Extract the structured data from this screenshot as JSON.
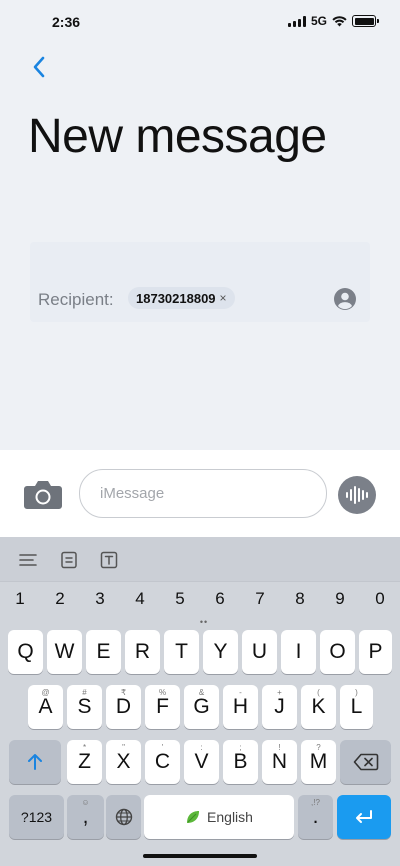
{
  "status_bar": {
    "time": "2:36",
    "network": "5G"
  },
  "header": {
    "title": "New message"
  },
  "recipient": {
    "label": "Recipient:",
    "chip_number": "18730218809",
    "chip_remove": "×"
  },
  "compose": {
    "placeholder": "iMessage"
  },
  "keyboard": {
    "numbers": [
      "1",
      "2",
      "3",
      "4",
      "5",
      "6",
      "7",
      "8",
      "9",
      "0"
    ],
    "row1": [
      "Q",
      "W",
      "E",
      "R",
      "T",
      "Y",
      "U",
      "I",
      "O",
      "P"
    ],
    "row2": [
      {
        "key": "A",
        "hint": "@"
      },
      {
        "key": "S",
        "hint": "#"
      },
      {
        "key": "D",
        "hint": "₹"
      },
      {
        "key": "F",
        "hint": "%"
      },
      {
        "key": "G",
        "hint": "&"
      },
      {
        "key": "H",
        "hint": "-"
      },
      {
        "key": "J",
        "hint": "+"
      },
      {
        "key": "K",
        "hint": "("
      },
      {
        "key": "L",
        "hint": ")"
      }
    ],
    "row3": [
      {
        "key": "Z",
        "hint": "*"
      },
      {
        "key": "X",
        "hint": "\""
      },
      {
        "key": "C",
        "hint": "'"
      },
      {
        "key": "V",
        "hint": ":"
      },
      {
        "key": "B",
        "hint": ";"
      },
      {
        "key": "N",
        "hint": "!"
      },
      {
        "key": "M",
        "hint": "?"
      }
    ],
    "symbols_label": "?123",
    "comma_label": ",",
    "space_label": "English",
    "period_label": ".",
    "period_hint": ",!?",
    "accent_color": "#1a9bf0"
  }
}
